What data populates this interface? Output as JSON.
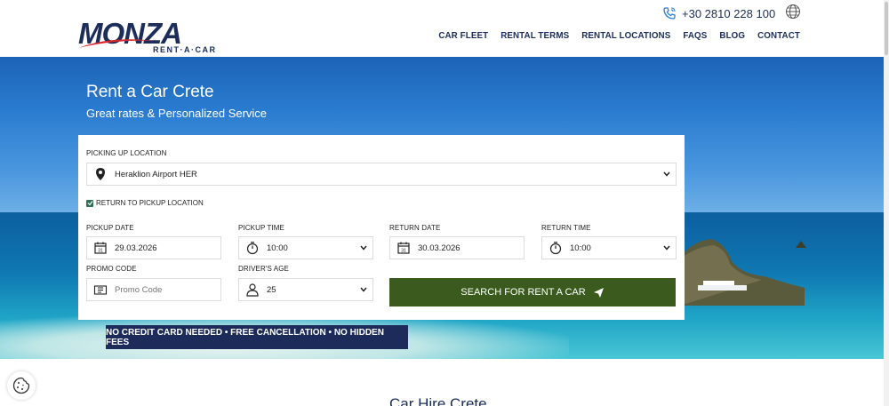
{
  "header": {
    "logo_text": "MONZA",
    "logo_sub": "RENT·A·CAR",
    "phone": "+30 2810 228 100",
    "nav": [
      {
        "label": "CAR FLEET"
      },
      {
        "label": "RENTAL TERMS"
      },
      {
        "label": "RENTAL LOCATIONS"
      },
      {
        "label": "FAQS"
      },
      {
        "label": "BLOG"
      },
      {
        "label": "CONTACT"
      }
    ]
  },
  "hero": {
    "title": "Rent a Car Crete",
    "subtitle": "Great rates & Personalized Service"
  },
  "form": {
    "pickup_location_label": "PICKING UP LOCATION",
    "pickup_location_value": "Heraklion Airport HER",
    "return_checkbox_label": "RETURN TO PICKUP LOCATION",
    "pickup_date_label": "PICKUP DATE",
    "pickup_date_value": "29.03.2026",
    "pickup_time_label": "PICKUP TIME",
    "pickup_time_value": "10:00",
    "return_date_label": "RETURN DATE",
    "return_date_value": "30.03.2026",
    "return_time_label": "RETURN TIME",
    "return_time_value": "10:00",
    "promo_label": "PROMO CODE",
    "promo_placeholder": "Promo Code",
    "age_label": "DRIVER'S AGE",
    "age_value": "25",
    "search_label": "SEARCH FOR RENT A CAR"
  },
  "banner": {
    "text": "NO CREDIT CARD NEEDED • FREE CANCELLATION • NO HIDDEN FEES"
  },
  "section": {
    "title": "Car Hire Crete"
  },
  "colors": {
    "brand_navy": "#1c2d5a",
    "brand_red": "#d7262b",
    "search_button": "#3a5a1e"
  }
}
